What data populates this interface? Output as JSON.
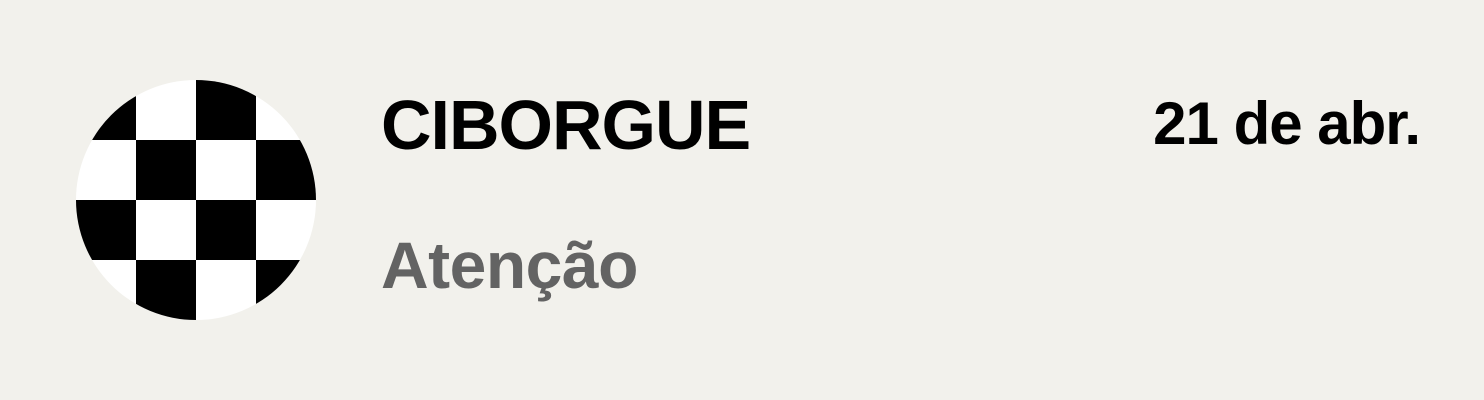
{
  "item": {
    "icon": "checkerboard-avatar-icon",
    "title": "CIBORGUE",
    "subtitle": "Atenção",
    "date": "21 de abr."
  },
  "colors": {
    "background": "#f2f1ec",
    "title": "#000000",
    "subtitle": "#636363",
    "checker_dark": "#000000",
    "checker_light": "#ffffff"
  }
}
